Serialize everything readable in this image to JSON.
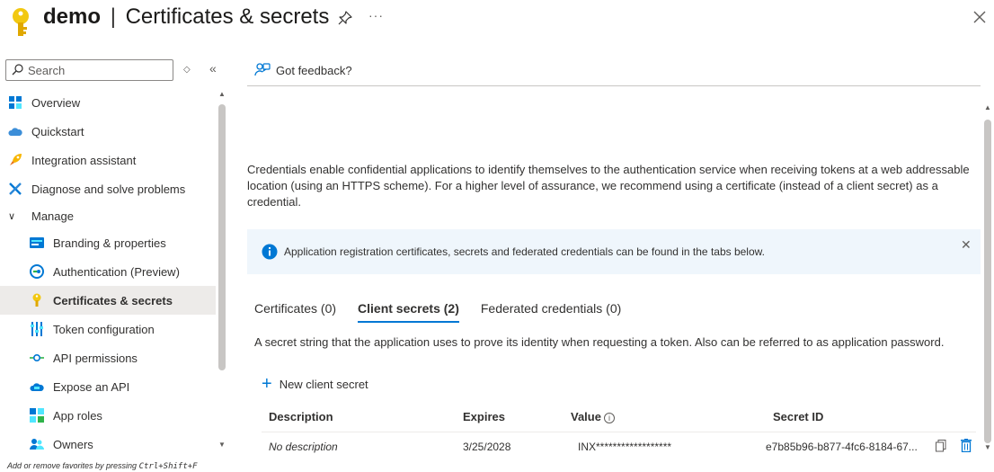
{
  "header": {
    "app_name": "demo",
    "separator": "|",
    "page_title": "Certificates & secrets",
    "more_label": "···",
    "close_label": "✕"
  },
  "sidebar": {
    "search_placeholder": "Search",
    "items": [
      {
        "label": "Overview",
        "icon": "overview-icon"
      },
      {
        "label": "Quickstart",
        "icon": "quickstart-icon"
      },
      {
        "label": "Integration assistant",
        "icon": "rocket-icon"
      },
      {
        "label": "Diagnose and solve problems",
        "icon": "wrench-icon"
      }
    ],
    "group_label": "Manage",
    "manage_items": [
      {
        "label": "Branding & properties",
        "icon": "branding-icon"
      },
      {
        "label": "Authentication (Preview)",
        "icon": "authentication-icon"
      },
      {
        "label": "Certificates & secrets",
        "icon": "key-icon",
        "active": true
      },
      {
        "label": "Token configuration",
        "icon": "token-icon"
      },
      {
        "label": "API permissions",
        "icon": "api-permissions-icon"
      },
      {
        "label": "Expose an API",
        "icon": "cloud-icon"
      },
      {
        "label": "App roles",
        "icon": "app-roles-icon"
      },
      {
        "label": "Owners",
        "icon": "owners-icon"
      }
    ],
    "favorites_hint_prefix": "Add or remove favorites by pressing ",
    "favorites_hint_keys": "Ctrl+Shift+F"
  },
  "main": {
    "feedback_label": "Got feedback?",
    "description": "Credentials enable confidential applications to identify themselves to the authentication service when receiving tokens at a web addressable location (using an HTTPS scheme). For a higher level of assurance, we recommend using a certificate (instead of a client secret) as a credential.",
    "info_banner": "Application registration certificates, secrets and federated credentials can be found in the tabs below.",
    "tabs": [
      {
        "label": "Certificates (0)"
      },
      {
        "label": "Client secrets (2)",
        "active": true
      },
      {
        "label": "Federated credentials (0)"
      }
    ],
    "secrets_description": "A secret string that the application uses to prove its identity when requesting a token. Also can be referred to as application password.",
    "new_secret_label": "New client secret",
    "table": {
      "columns": [
        "Description",
        "Expires",
        "Value",
        "Secret ID"
      ],
      "rows": [
        {
          "description": "No description",
          "expires": "3/25/2028",
          "value": "INX******************",
          "secret_id": "e7b85b96-b877-4fc6-8184-67..."
        }
      ]
    }
  },
  "colors": {
    "accent": "#0078d4",
    "key_gold": "#f2c811",
    "banner_bg": "#eff6fc",
    "active_nav_bg": "#edebe9"
  }
}
